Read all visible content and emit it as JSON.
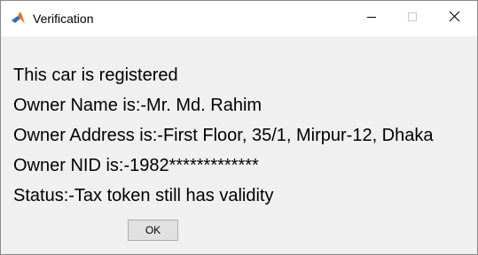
{
  "window": {
    "title": "Verification",
    "controls": {
      "minimize": "—",
      "maximize": "□",
      "close": "✕"
    }
  },
  "message": {
    "lines": [
      "This car is registered",
      "Owner Name is:-Mr. Md. Rahim",
      "Owner Address is:-First Floor, 35/1, Mirpur-12, Dhaka",
      "Owner NID is:-1982*************",
      "Status:-Tax token still has validity"
    ]
  },
  "buttons": {
    "ok_label": "OK"
  },
  "icons": {
    "app": "matlab-icon",
    "minimize": "minimize-icon",
    "maximize": "maximize-icon",
    "close": "close-icon"
  },
  "colors": {
    "titlebar": "#ffffff",
    "body": "#f0f0f0",
    "button_face": "#e1e1e1",
    "button_border": "#adadad",
    "window_border": "#8a8a8a"
  }
}
